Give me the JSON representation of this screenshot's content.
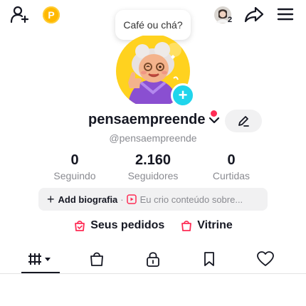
{
  "header": {
    "bubble_text": "Café ou chá?",
    "coin_letter": "P",
    "notifications_count": "2",
    "icons": [
      "add-friend-icon",
      "coin-icon",
      "account-avatar-icon",
      "share-icon",
      "menu-icon"
    ]
  },
  "profile": {
    "username": "pensaempreende",
    "handle": "@pensaempreende"
  },
  "stats": [
    {
      "value": "0",
      "label": "Seguindo"
    },
    {
      "value": "2.160",
      "label": "Seguidores"
    },
    {
      "value": "0",
      "label": "Curtidas"
    }
  ],
  "bio": {
    "add_label": "Add biografia",
    "separator": "·",
    "sample": "Eu crio conteúdo sobre..."
  },
  "links": {
    "orders": "Seus pedidos",
    "showcase": "Vitrine"
  },
  "tabs": [
    {
      "name": "videos",
      "icon": "grid-icon"
    },
    {
      "name": "shop",
      "icon": "bag-icon"
    },
    {
      "name": "private",
      "icon": "lock-icon"
    },
    {
      "name": "saved",
      "icon": "bookmark-icon"
    },
    {
      "name": "liked",
      "icon": "heart-icon"
    }
  ],
  "colors": {
    "accent": "#fe2c55",
    "badge": "#20d5ec",
    "coin": "#ffb800",
    "showcase": "#fe2c55"
  }
}
